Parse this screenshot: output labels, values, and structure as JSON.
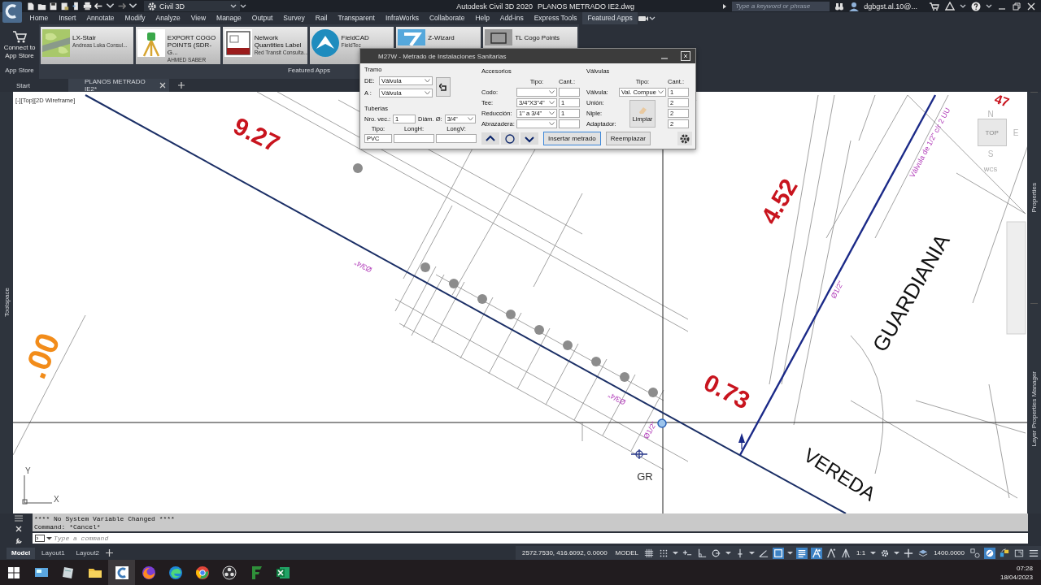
{
  "title_bar": {
    "workspace": "Civil 3D",
    "app_title": "Autodesk Civil 3D 2020",
    "file_title": "PLANOS METRADO IE2.dwg",
    "search_placeholder": "Type a keyword or phrase",
    "user": "dgbgst.al.10@..."
  },
  "menu_tabs": [
    {
      "label": "Home",
      "selected": false
    },
    {
      "label": "Insert",
      "selected": false
    },
    {
      "label": "Annotate",
      "selected": false
    },
    {
      "label": "Modify",
      "selected": false
    },
    {
      "label": "Analyze",
      "selected": false
    },
    {
      "label": "View",
      "selected": false
    },
    {
      "label": "Manage",
      "selected": false
    },
    {
      "label": "Output",
      "selected": false
    },
    {
      "label": "Survey",
      "selected": false
    },
    {
      "label": "Rail",
      "selected": false
    },
    {
      "label": "Transparent",
      "selected": false
    },
    {
      "label": "InfraWorks",
      "selected": false
    },
    {
      "label": "Collaborate",
      "selected": false
    },
    {
      "label": "Help",
      "selected": false
    },
    {
      "label": "Add-ins",
      "selected": false
    },
    {
      "label": "Express Tools",
      "selected": false
    },
    {
      "label": "Featured Apps",
      "selected": true
    }
  ],
  "ribbon": {
    "app_store": {
      "button": "Connect to App Store",
      "panel": "App Store"
    },
    "featured": {
      "panel": "Featured Apps",
      "apps": [
        {
          "name": "LX-Stair",
          "author": "Andreas Luka Consul..."
        },
        {
          "name": "EXPORT COGO POINTS (SDR-G...",
          "author": "AHMED SABER"
        },
        {
          "name": "Network Quantities Label",
          "author": "Red Transit Consulta..."
        },
        {
          "name": "FieldCAD",
          "author": "FieldTec"
        },
        {
          "name": "Z-Wizard"
        },
        {
          "name": "TL Cogo Points"
        }
      ]
    }
  },
  "file_tabs": [
    {
      "label": "Start",
      "selected": false,
      "closable": false
    },
    {
      "label": "PLANOS METRADO IE2*",
      "selected": true,
      "closable": true
    }
  ],
  "viewport": {
    "label": "[-][Top][2D Wireframe]",
    "viewcube": {
      "face": "TOP",
      "compass": [
        "N",
        "E",
        "S"
      ],
      "ucs_name": "WCS"
    },
    "axis": {
      "x": "X",
      "y": "Y"
    },
    "labels": [
      {
        "text": "9.27",
        "kind": "dimension"
      },
      {
        "text": "4.52",
        "kind": "dimension"
      },
      {
        "text": "0.73",
        "kind": "dimension"
      },
      {
        "text": "47",
        "kind": "dimension"
      },
      {
        "text": "GUARDIANIA",
        "kind": "area"
      },
      {
        "text": "VEREDA",
        "kind": "area"
      },
      {
        "text": "GR",
        "kind": "marker"
      },
      {
        "text": ".00",
        "kind": "elevation"
      },
      {
        "text": "Ø3/4\"",
        "kind": "pipe"
      },
      {
        "text": "Ø3/4\"",
        "kind": "pipe"
      },
      {
        "text": "Ø1/2\"",
        "kind": "pipe"
      },
      {
        "text": "Ø1/2\"",
        "kind": "pipe"
      },
      {
        "text": "Válvula de 1/2\" c/r 2 UU",
        "kind": "pipe"
      }
    ]
  },
  "side_palettes": {
    "left": "Toolspace",
    "right": [
      "Properties",
      "Layer Properties Manager"
    ]
  },
  "dialog": {
    "title": "M27W - Metrado de Instalaciones Sanitarias",
    "tramo": {
      "label": "Tramo",
      "fields": [
        {
          "label": "DE:",
          "value": "Válvula"
        },
        {
          "label": "A :",
          "value": "Válvula"
        }
      ]
    },
    "tuberias": {
      "label": "Tuberias",
      "count_label": "Nro. vec.:",
      "count": "1",
      "diameter_label": "Diám. Ø:",
      "diameter": "3/4\"",
      "type_label": "Tipo:",
      "type": "PVC",
      "longh_label": "LongH:",
      "longv_label": "LongV:"
    },
    "accesorios": {
      "label": "Accesorios",
      "type_header": "Tipo:",
      "qty_header": "Cant.:",
      "rows": [
        {
          "label": "Codo:"
        },
        {
          "label": "Tee:",
          "type": "3/4\"X3\"4\"",
          "qty": "1"
        },
        {
          "label": "Reducción:",
          "type": "1\" a 3/4\"",
          "qty": "1"
        },
        {
          "label": "Abrazadera:"
        }
      ]
    },
    "valvulas": {
      "label": "Válvulas",
      "type_header": "Tipo:",
      "qty_header": "Cant.:",
      "rows": [
        {
          "label": "Válvula:",
          "type": "Val. Compue",
          "qty": "1"
        },
        {
          "label": "Unión:",
          "qty": "2"
        },
        {
          "label": "Niple:",
          "qty": "2"
        },
        {
          "label": "Adaptador:",
          "qty": "2"
        }
      ],
      "clear_button": "Limpiar"
    },
    "buttons": [
      {
        "label": "Insertar metrado",
        "focused": true
      },
      {
        "label": "Reemplazar",
        "focused": false
      }
    ]
  },
  "command_line": {
    "history": [
      "**** No System Variable Changed ****",
      "Command: *Cancel*"
    ],
    "placeholder": "Type a command"
  },
  "layout_tabs": [
    {
      "label": "Model",
      "selected": true
    },
    {
      "label": "Layout1",
      "selected": false
    },
    {
      "label": "Layout2",
      "selected": false
    }
  ],
  "status_bar": {
    "coordinates": "2572.7530, 416.6092, 0.0000",
    "items": [
      {
        "kind": "text",
        "label": "MODEL"
      },
      {
        "kind": "toggle",
        "on": false
      },
      {
        "kind": "toggle",
        "on": false
      },
      {
        "kind": "caret"
      },
      {
        "kind": "toggle",
        "on": false
      },
      {
        "kind": "toggle",
        "on": false
      },
      {
        "kind": "toggle",
        "on": false
      },
      {
        "kind": "caret"
      },
      {
        "kind": "toggle",
        "on": false
      },
      {
        "kind": "caret"
      },
      {
        "kind": "toggle",
        "on": false
      },
      {
        "kind": "toggle",
        "on": true
      },
      {
        "kind": "caret"
      },
      {
        "kind": "toggle",
        "on": true
      },
      {
        "kind": "toggle",
        "on": true
      },
      {
        "kind": "toggle",
        "on": false
      },
      {
        "kind": "tool"
      },
      {
        "kind": "text",
        "label": "1:1"
      },
      {
        "kind": "caret"
      },
      {
        "kind": "tool"
      },
      {
        "kind": "caret"
      },
      {
        "kind": "tool"
      },
      {
        "kind": "tool"
      },
      {
        "kind": "text",
        "label": "1400.0000"
      },
      {
        "kind": "tool"
      },
      {
        "kind": "toggle",
        "on": true
      },
      {
        "kind": "tool"
      },
      {
        "kind": "tool"
      },
      {
        "kind": "tool"
      }
    ]
  },
  "taskbar": {
    "apps": [
      {
        "selected": false
      },
      {
        "selected": false
      },
      {
        "selected": false
      },
      {
        "selected": true
      },
      {
        "selected": false
      },
      {
        "selected": false
      },
      {
        "selected": false
      },
      {
        "selected": false
      },
      {
        "selected": false
      },
      {
        "selected": false
      }
    ],
    "time": "07:28",
    "date": "18/04/2023"
  }
}
